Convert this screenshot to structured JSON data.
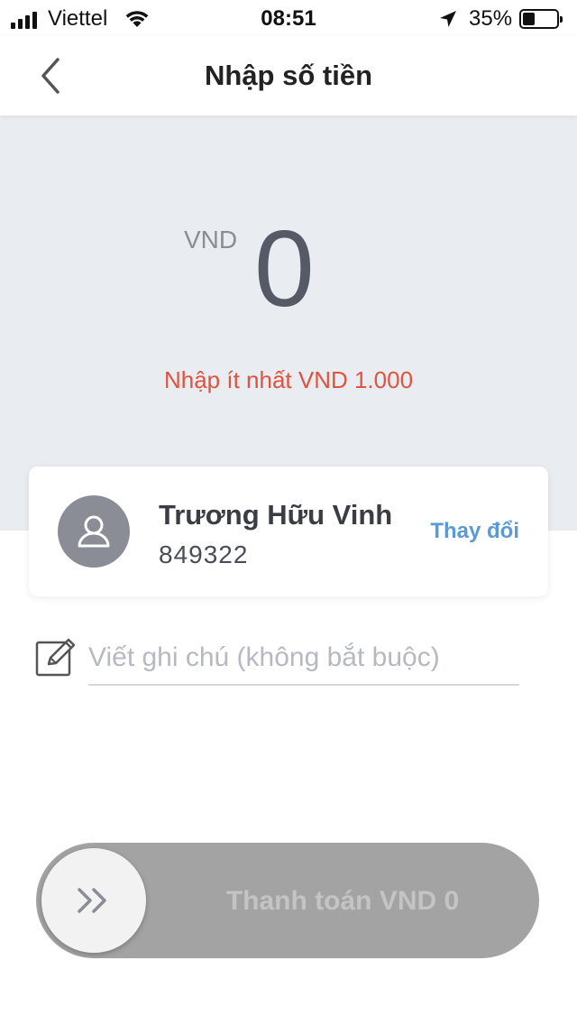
{
  "status_bar": {
    "carrier": "Viettel",
    "time": "08:51",
    "battery_percent": "35%",
    "battery_level": 0.35
  },
  "header": {
    "title": "Nhập số tiền",
    "back_icon": "chevron-left-icon"
  },
  "amount": {
    "currency": "VND",
    "value": "0",
    "min_warning": "Nhập ít nhất VND 1.000"
  },
  "recipient": {
    "name": "Trương Hữu Vinh",
    "phone": "849322",
    "change_label": "Thay đổi",
    "avatar_icon": "user-icon"
  },
  "note": {
    "placeholder": "Viết ghi chú (không bắt buộc)",
    "value": "",
    "icon": "edit-note-icon"
  },
  "pay_button": {
    "label": "Thanh toán VND 0",
    "knob_icon": "double-chevron-right-icon"
  },
  "colors": {
    "panel_bg": "#e9ecf1",
    "warning": "#e0533e",
    "link": "#5a9ad6",
    "slider_bg": "#a3a3a3"
  }
}
